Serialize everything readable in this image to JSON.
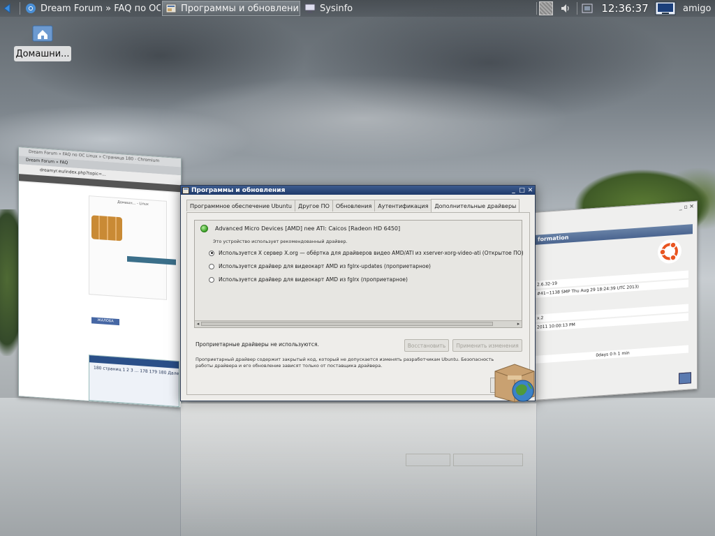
{
  "taskbar": {
    "tasks": [
      {
        "label": "Dream Forum » FAQ по OC...",
        "icon": "chromium-icon"
      },
      {
        "label": "Программы и обновления",
        "icon": "software-properties-icon",
        "active": true
      },
      {
        "label": "Sysinfo",
        "icon": "monitor-icon"
      }
    ],
    "clock": "12:36:37",
    "user": "amigo"
  },
  "desktop": {
    "home_label": "Домашни..."
  },
  "browser": {
    "title": "Dream Forum » FAQ по OC Linux » Страница 180 - Chromium",
    "tab": "Dream Forum » FAQ",
    "url": "dreamyr.eu/index.php?topic=...",
    "post_title": "Домашн... - Linux",
    "pager_text": "180 страниц  1  2  3 ... 178  179  180  Далее",
    "button": "ЖАЛОБА"
  },
  "sysinfo": {
    "header": "formation",
    "rows": [
      "2.6.32-19",
      "#41~1138 SMP Thu Aug 29 18:24:39 UTC 2013)",
      "x.2",
      "2011 10:00:13 PM",
      "0days 0 h 1 min"
    ]
  },
  "dialog": {
    "title": "Программы и обновления",
    "tabs": [
      "Программное обеспечение Ubuntu",
      "Другое ПО",
      "Обновления",
      "Аутентификация",
      "Дополнительные драйверы"
    ],
    "active_tab": 4,
    "device": "Advanced Micro Devices [AMD] nee ATI: Caicos [Radeon HD 6450]",
    "device_note": "Это устройство использует рекомендованный драйвер.",
    "options": [
      {
        "label": "Используется X сервер X.org — обёртка для драйверов видео AMD/ATI из xserver-xorg-video-ati (Открытое ПО)",
        "selected": true
      },
      {
        "label": "Используется драйвер для видеокарт AMD из fglrx-updates (проприетарное)",
        "selected": false
      },
      {
        "label": "Используется драйвер для видеокарт AMD из fglrx (проприетарное)",
        "selected": false
      }
    ],
    "status": "Проприетарные драйверы не используются.",
    "revert_button": "Восстановить",
    "apply_button": "Применить изменения",
    "description": "Проприетарный драйвер содержит закрытый код, который не допускается изменять разработчикам Ubuntu. Безопасность работы драйвера и его обновление зависят только от поставщика драйвера."
  }
}
